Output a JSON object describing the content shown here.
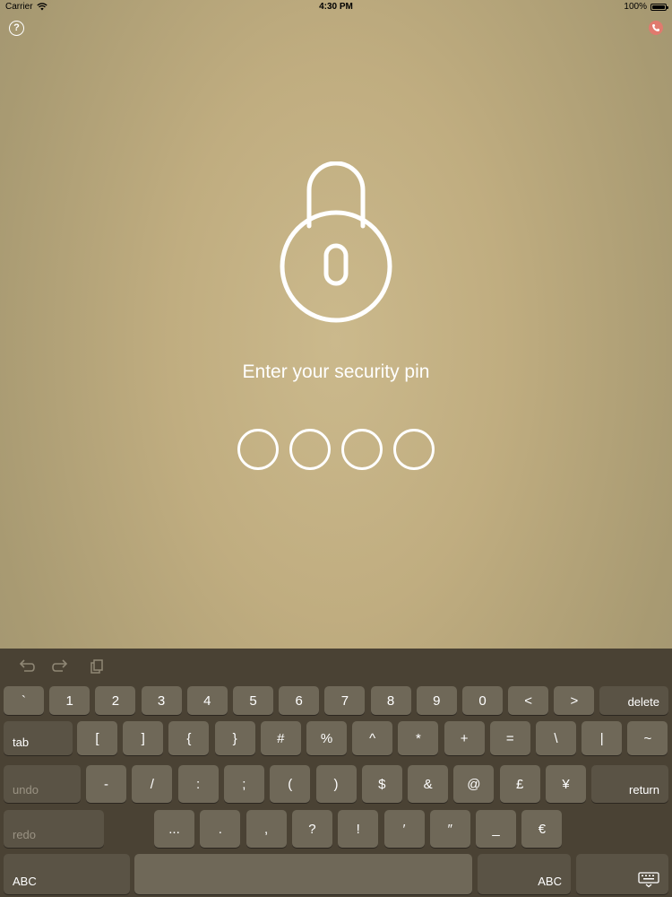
{
  "status_bar": {
    "carrier": "Carrier",
    "time": "4:30 PM",
    "battery": "100%"
  },
  "header": {
    "help_label": "?"
  },
  "main": {
    "prompt": "Enter your security pin",
    "pin_length": 4,
    "pin_entered": 0
  },
  "keyboard": {
    "toolbar": [
      "undo-icon",
      "redo-icon",
      "paste-icon"
    ],
    "row1": [
      "`",
      "1",
      "2",
      "3",
      "4",
      "5",
      "6",
      "7",
      "8",
      "9",
      "0",
      "<",
      ">"
    ],
    "row1_action": "delete",
    "row2_action": "tab",
    "row2": [
      "[",
      "]",
      "{",
      "}",
      "#",
      "%",
      "^",
      "*",
      "+",
      "=",
      "\\",
      "|",
      "~"
    ],
    "row3_action": "undo",
    "row3": [
      "-",
      "/",
      ":",
      ";",
      "(",
      ")",
      "$",
      "&",
      "@",
      "£",
      "¥"
    ],
    "row3_return": "return",
    "row4_action": "redo",
    "row4": [
      "...",
      ".",
      ",",
      "?",
      "!",
      "′",
      "″",
      "_",
      "€"
    ],
    "row5_left": "ABC",
    "row5_right": "ABC",
    "row5_icon": "keyboard-dismiss-icon"
  }
}
